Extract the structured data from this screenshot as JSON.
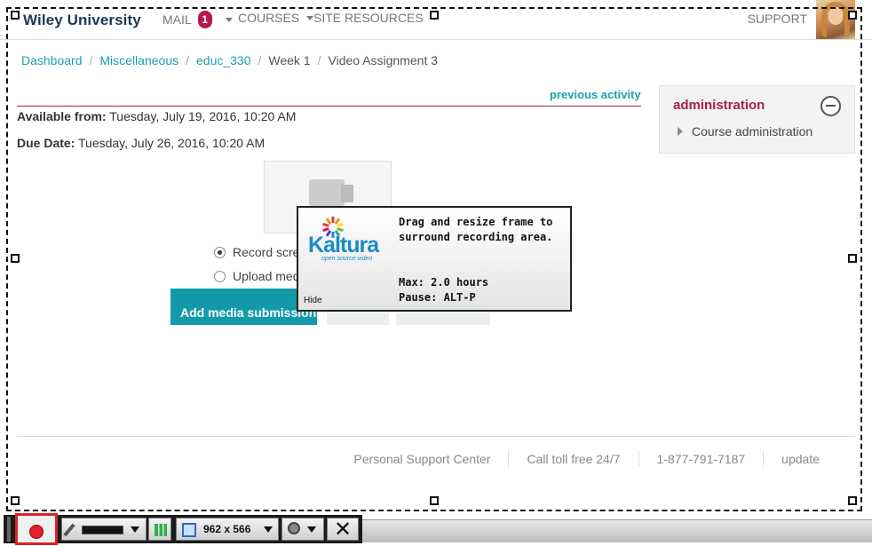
{
  "header": {
    "brand": "Wiley University",
    "nav": [
      {
        "label": "MAIL",
        "badge": "1"
      },
      {
        "label": "COURSES"
      },
      {
        "label": "SITE RESOURCES"
      }
    ],
    "support": "SUPPORT"
  },
  "breadcrumb": {
    "items": [
      "Dashboard",
      "Miscellaneous",
      "educ_330",
      "Week 1",
      "Video Assignment 3"
    ],
    "separator": "/"
  },
  "assignment": {
    "previous_activity": "previous activity",
    "available_label": "Available from:",
    "available_value": "Tuesday, July 19, 2016, 10:20 AM",
    "due_label": "Due Date:",
    "due_value": "Tuesday, July 26, 2016, 10:20 AM",
    "options": [
      "Record screen",
      "Upload media or record from webcam"
    ],
    "selected_option": 0,
    "add_media_button": "Add media submission"
  },
  "admin_block": {
    "title": "administration",
    "item": "Course administration"
  },
  "footer": {
    "items": [
      "Personal Support Center",
      "Call toll free 24/7",
      "1-877-791-7187",
      "update"
    ]
  },
  "kaltura_popup": {
    "logo_text": "Kaltura",
    "logo_tagline": "open source video",
    "message_line1": "Drag and resize frame to",
    "message_line2": "surround recording area.",
    "max_line": "Max: 2.0 hours",
    "pause_line": "Pause: ALT-P",
    "hide": "Hide"
  },
  "recorder_toolbar": {
    "size_text": "962 x 566",
    "close_symbol": "✕",
    "icons": [
      "record-icon",
      "pen-icon",
      "audio-level-icon",
      "resize-icon",
      "webcam-icon",
      "close-icon"
    ]
  },
  "colors": {
    "brand": "#1b3a57",
    "link": "#1a9fae",
    "accent": "#a41f53",
    "button": "#139aa9",
    "record": "#e0202a"
  }
}
